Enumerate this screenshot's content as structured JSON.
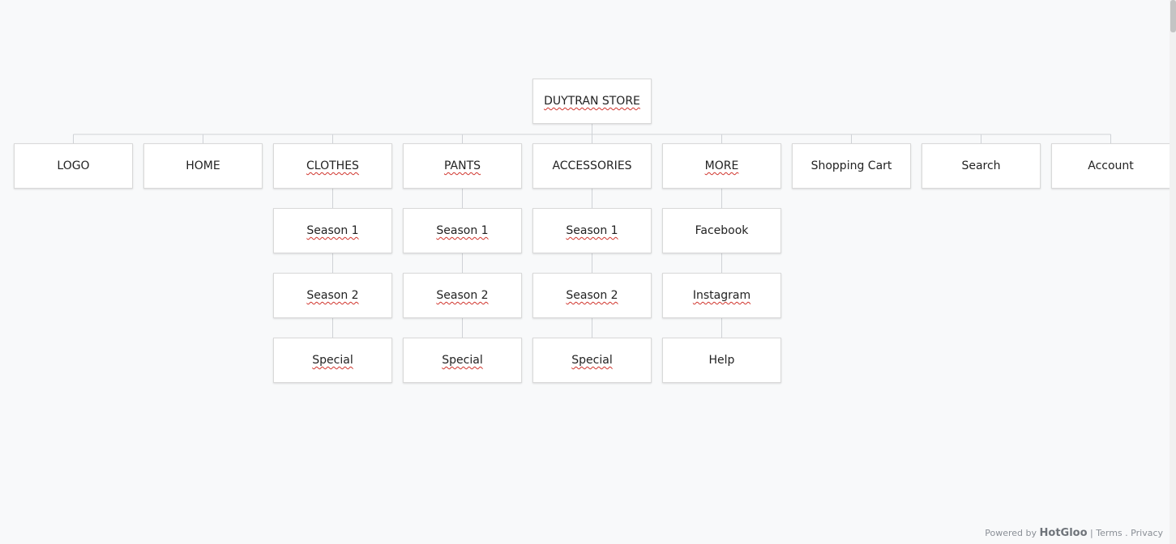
{
  "sitemap": {
    "root": {
      "label": "DUYTRAN STORE",
      "spellcheck": true
    },
    "columns": [
      {
        "label": "LOGO",
        "spellcheck": false,
        "children": []
      },
      {
        "label": "HOME",
        "spellcheck": false,
        "children": []
      },
      {
        "label": "CLOTHES",
        "spellcheck": true,
        "children": [
          {
            "label": "Season 1",
            "spellcheck": true
          },
          {
            "label": "Season 2",
            "spellcheck": true
          },
          {
            "label": "Special",
            "spellcheck": true
          }
        ]
      },
      {
        "label": "PANTS",
        "spellcheck": true,
        "children": [
          {
            "label": "Season 1",
            "spellcheck": true
          },
          {
            "label": "Season 2",
            "spellcheck": true
          },
          {
            "label": "Special",
            "spellcheck": true
          }
        ]
      },
      {
        "label": "ACCESSORIES",
        "spellcheck": false,
        "children": [
          {
            "label": "Season 1",
            "spellcheck": true
          },
          {
            "label": "Season 2",
            "spellcheck": true
          },
          {
            "label": "Special",
            "spellcheck": true
          }
        ]
      },
      {
        "label": "MORE",
        "spellcheck": true,
        "children": [
          {
            "label": "Facebook",
            "spellcheck": false
          },
          {
            "label": "Instagram",
            "spellcheck": true
          },
          {
            "label": "Help",
            "spellcheck": false
          }
        ]
      },
      {
        "label": "Shopping Cart",
        "spellcheck": false,
        "children": []
      },
      {
        "label": "Search",
        "spellcheck": false,
        "children": []
      },
      {
        "label": "Account",
        "spellcheck": false,
        "children": []
      }
    ]
  },
  "footer": {
    "powered_by": "Powered by",
    "brand": "HotGloo",
    "separator": "|",
    "terms": "Terms",
    "dot": ".",
    "privacy": "Privacy"
  },
  "colors": {
    "background": "#f8f9fa",
    "node_border": "#d9d9d9",
    "connector": "#cfd2d6",
    "spellcheck_underline": "#d0342c"
  }
}
